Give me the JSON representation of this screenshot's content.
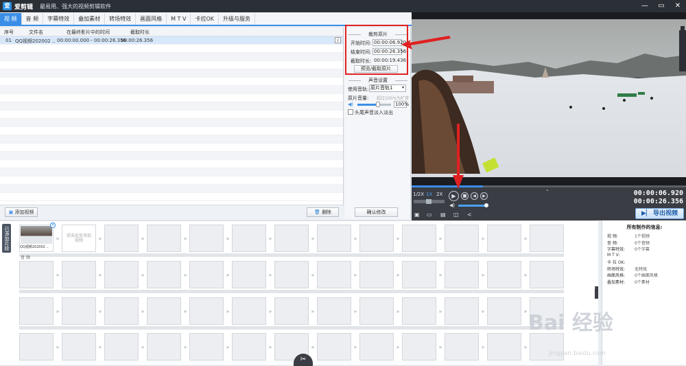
{
  "app": {
    "name": "爱剪辑",
    "slogan": "最易用、强大的视频剪辑软件",
    "logo_letter": "爱"
  },
  "window_buttons": [
    "—",
    "▭",
    "✕"
  ],
  "tabs": [
    "视 频",
    "音 频",
    "字幕特效",
    "叠加素材",
    "转场特效",
    "画面风格",
    "M T V",
    "卡拉OK",
    "升级与服务"
  ],
  "file_list": {
    "headers": [
      "序号",
      "文件名",
      "在最终影片中的时间",
      "截取时长"
    ],
    "rows": [
      {
        "index": "01",
        "name": "QQ视频202002 ..",
        "time": "00:00:00.000 - 00:00:26.356",
        "duration": "00:00:26.356"
      }
    ],
    "add_button": "添加视频",
    "delete_button": "删除"
  },
  "trim": {
    "title": "裁剪原片",
    "start_label": "开始时间:",
    "start_value": "00:00:06.920",
    "end_label": "结束时间:",
    "end_value": "00:00:26.356",
    "duration_label": "截取时长:",
    "duration_value": "00:00:19.436",
    "preview_button": "预览/截取原片"
  },
  "sound": {
    "title": "声音设置",
    "track_label": "使用音轨:",
    "track_value": "原片音轨1",
    "volume_label": "原片音量:",
    "volume_hint": "超过100%为扩音",
    "volume_value": "100%",
    "fade_label": "头尾声音淡入淡出"
  },
  "confirm_button": "确认修改",
  "player": {
    "speed_options": [
      "1/2X",
      "1X",
      "2X"
    ],
    "current_time": "00:00:06.920",
    "total_time": "00:00:26.356",
    "progress": 0.26,
    "export_button": "导出视频"
  },
  "timeline": {
    "side_label": "已添加片段",
    "first_clip_name": "QQ视频202002 ..",
    "placeholder": "双击此处添加视频",
    "audio_label": "音 频"
  },
  "info": {
    "title": "所有制作的信息:",
    "rows": [
      {
        "k": "视    频:",
        "v": "1个视频"
      },
      {
        "k": "音    频:",
        "v": "0个音频"
      },
      {
        "k": "字幕特效:",
        "v": "0个字幕"
      },
      {
        "k": "M  T  V:",
        "v": ""
      },
      {
        "k": "卡 拉 OK:",
        "v": ""
      },
      {
        "k": "转场特效:",
        "v": "无特效"
      },
      {
        "k": "画面风格:",
        "v": "0个画面风格"
      },
      {
        "k": "叠加素材:",
        "v": "0个素材"
      }
    ]
  },
  "watermark": {
    "text": "Bai 经验",
    "url": "jingyan.baidu.com"
  },
  "colors": {
    "accent": "#3a8ee6",
    "annotation": "#e02020"
  }
}
